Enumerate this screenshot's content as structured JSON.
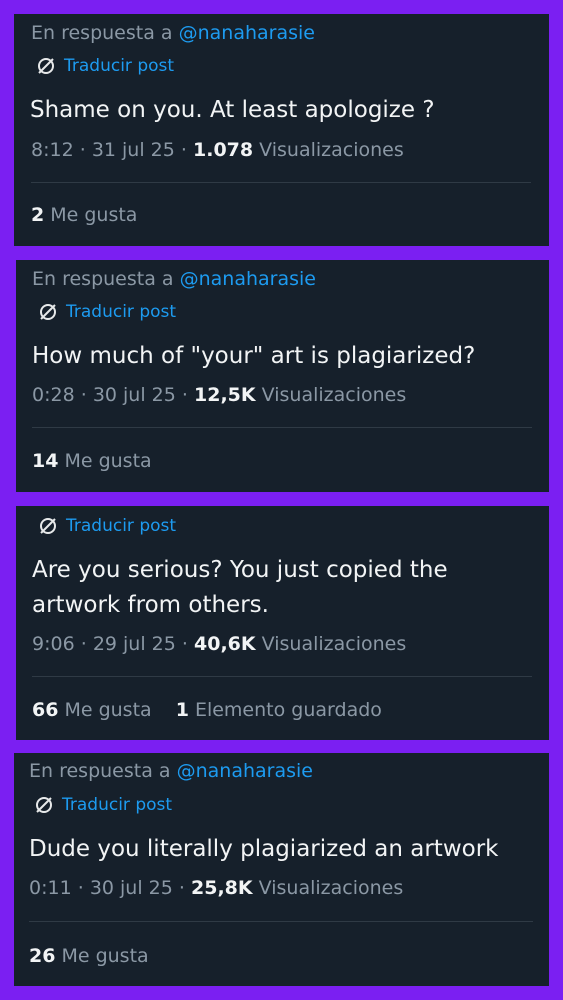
{
  "posts": [
    {
      "reply_prefix": "En respuesta a",
      "reply_handle": "@nanaharasie",
      "translate_label": "Traducir post",
      "text": "Shame on you. At least apologize ?",
      "time": "8:12",
      "date": "31 jul 25",
      "views_count": "1.078",
      "views_label": "Visualizaciones",
      "likes_count": "2",
      "likes_label": "Me gusta"
    },
    {
      "reply_prefix": "En respuesta a",
      "reply_handle": "@nanaharasie",
      "translate_label": "Traducir post",
      "text": "How much of \"your\" art is plagiarized?",
      "time": "0:28",
      "date": "30 jul 25",
      "views_count": "12,5K",
      "views_label": "Visualizaciones",
      "likes_count": "14",
      "likes_label": "Me gusta"
    },
    {
      "translate_label": "Traducir post",
      "text_line1": "Are you serious? You just copied the",
      "text_line2": "artwork from others.",
      "time": "9:06",
      "date": "29 jul 25",
      "views_count": "40,6K",
      "views_label": "Visualizaciones",
      "likes_count": "66",
      "likes_label": "Me gusta",
      "saved_count": "1",
      "saved_label": "Elemento guardado"
    },
    {
      "reply_prefix": "En respuesta a",
      "reply_handle": "@nanaharasie",
      "translate_label": "Traducir post",
      "text": "Dude you literally plagiarized an artwork",
      "time": "0:11",
      "date": "30 jul 25",
      "views_count": "25,8K",
      "views_label": "Visualizaciones",
      "likes_count": "26",
      "likes_label": "Me gusta"
    }
  ],
  "colors": {
    "background": "#7b1ff2",
    "card": "#16202b",
    "accent": "#1d9bf0",
    "secondary_text": "#8b98a5"
  }
}
